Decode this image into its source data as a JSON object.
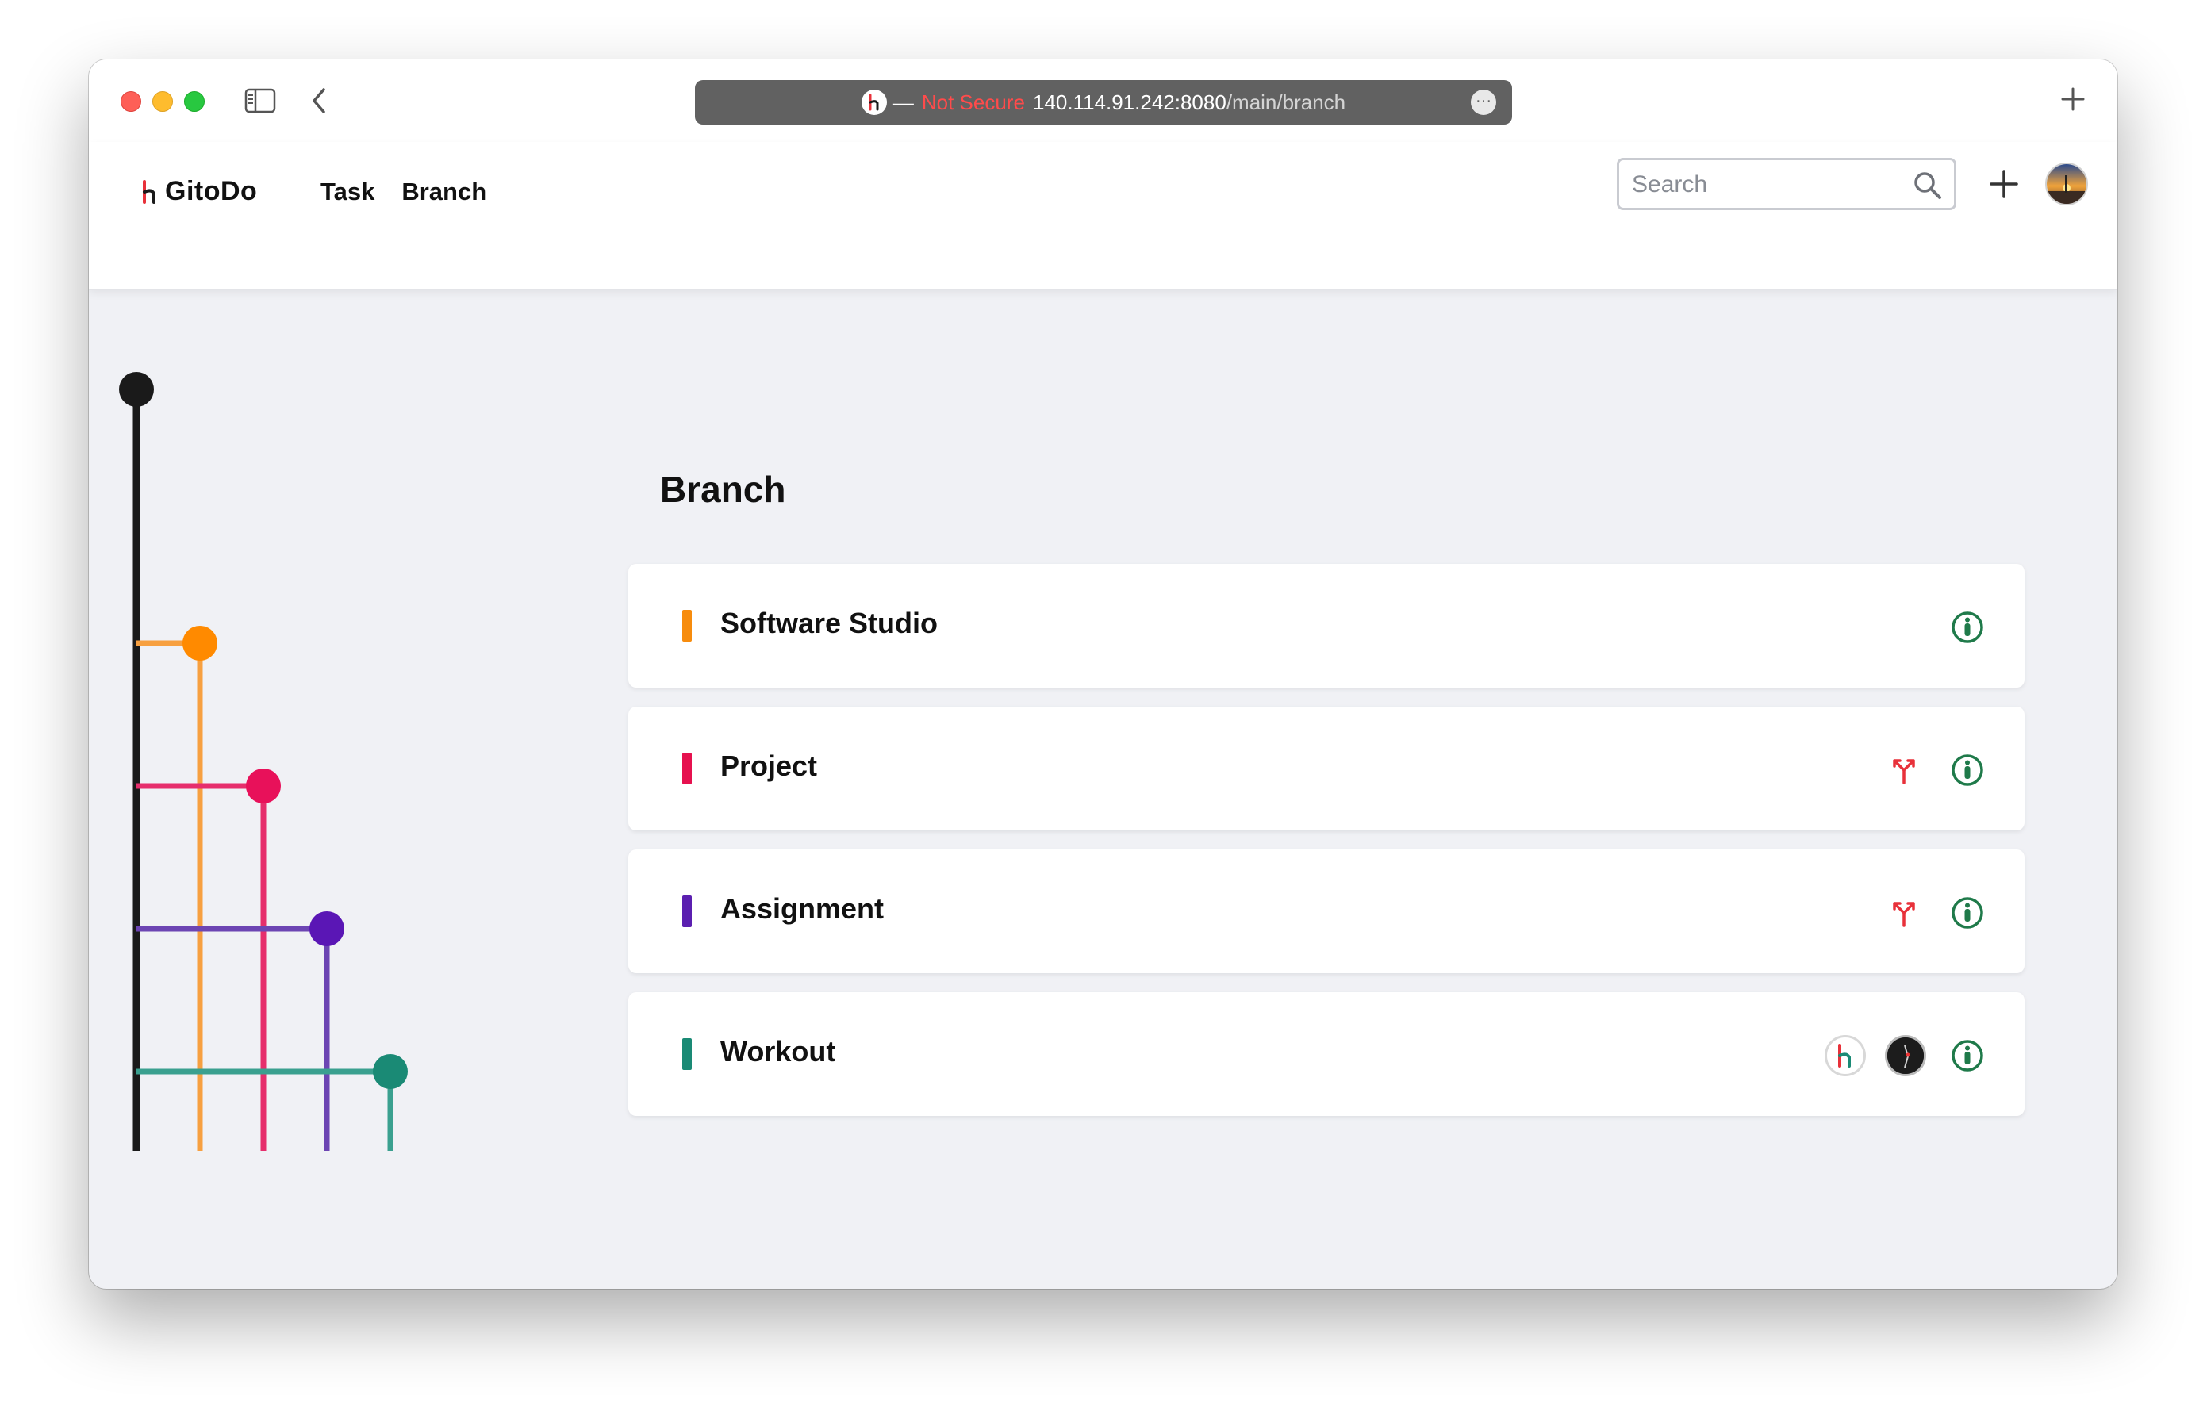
{
  "browser": {
    "address": {
      "separator": "—",
      "security": "Not Secure",
      "host": "140.114.91.242:8080",
      "path": "/main/branch"
    },
    "more_glyph": "···"
  },
  "navbar": {
    "brand": "GitoDo",
    "links": [
      "Task",
      "Branch"
    ],
    "search_placeholder": "Search"
  },
  "page": {
    "title": "Branch"
  },
  "branches": [
    {
      "name": "Software Studio",
      "color": "#f78c0d",
      "actions": [
        "info"
      ]
    },
    {
      "name": "Project",
      "color": "#e6114f",
      "actions": [
        "fork",
        "info"
      ]
    },
    {
      "name": "Assignment",
      "color": "#5b1fb0",
      "actions": [
        "fork",
        "info"
      ]
    },
    {
      "name": "Workout",
      "color": "#1a8a75",
      "actions": [
        "member-logo",
        "member-dark",
        "info"
      ]
    }
  ],
  "colors": {
    "trunk": "#1a1a1a",
    "accent_red": "#e8313a",
    "info_green": "#1f7a4a",
    "graph_lines": [
      "#f7a040",
      "#e62e6c",
      "#6c45b3",
      "#3aa08f"
    ],
    "graph_dots": [
      "#ff8a00",
      "#e8115a",
      "#5a16b5",
      "#1a8a75"
    ]
  }
}
